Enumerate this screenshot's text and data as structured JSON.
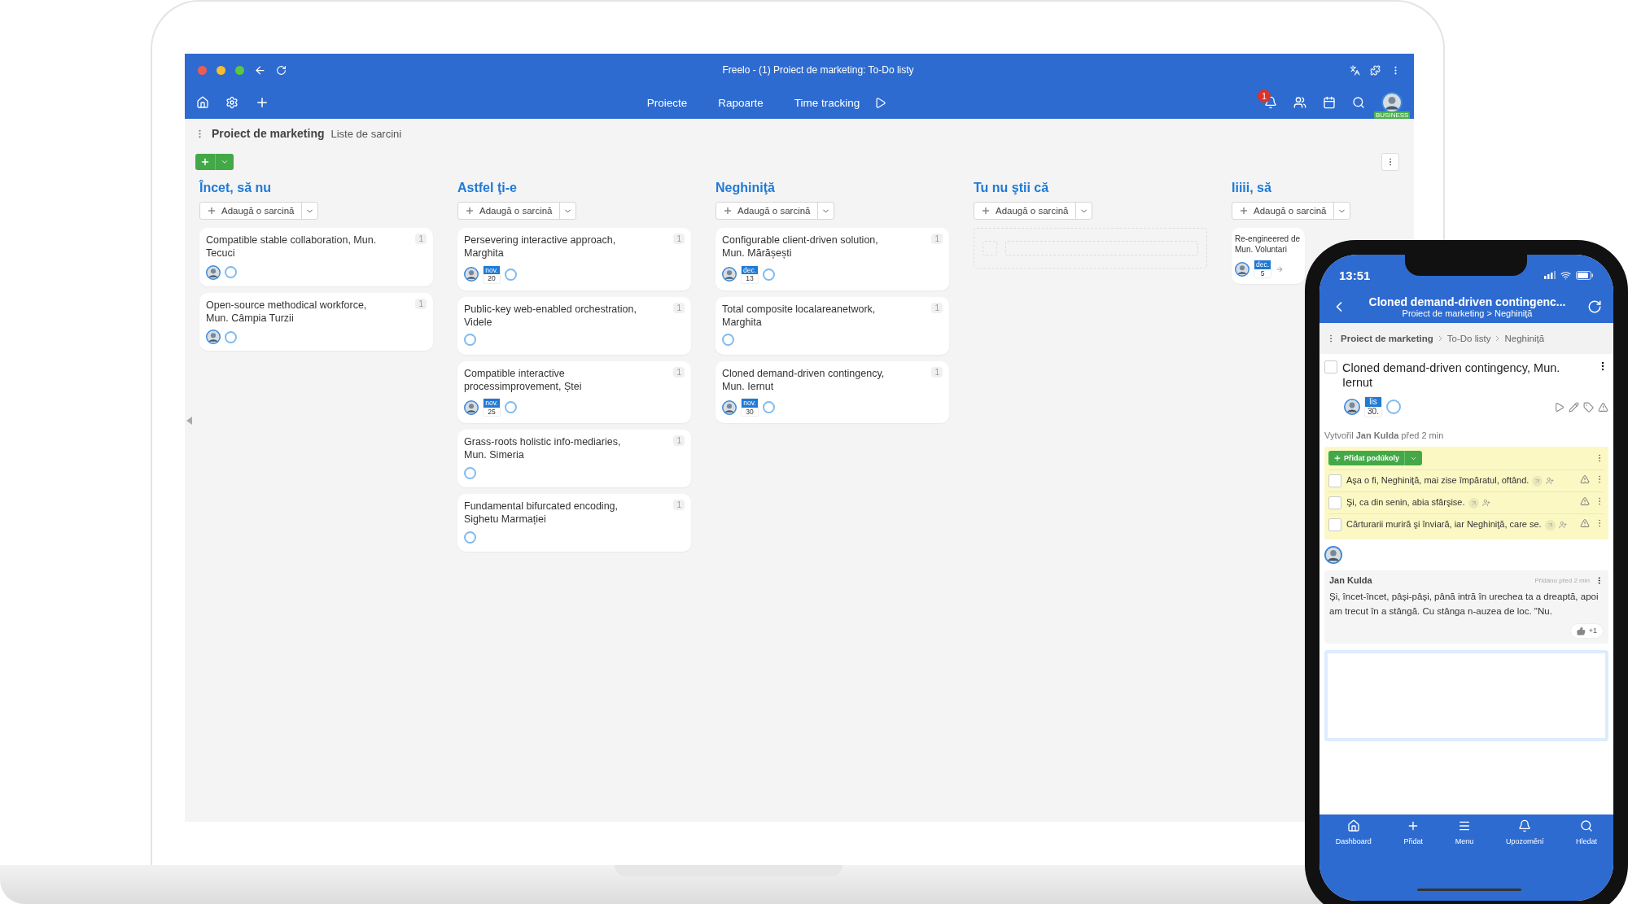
{
  "browser": {
    "title": "Freelo - (1) Proiect de marketing: To-Do listy"
  },
  "nav": {
    "items": [
      "Proiecte",
      "Rapoarte",
      "Time tracking"
    ],
    "notification_count": "1",
    "plan_badge": "BUSINESS"
  },
  "breadcrumb": {
    "project": "Proiect de marketing",
    "page": "Liste de sarcini"
  },
  "columns": [
    {
      "title": "Încet, să nu",
      "add_label": "Adaugă o sarcină",
      "cards": [
        {
          "title": "Compatible stable collaboration, Mun. Tecuci",
          "count": "1",
          "assignee": true
        },
        {
          "title": "Open-source methodical workforce, Mun. Câmpia Turzii",
          "count": "1",
          "assignee": true
        }
      ]
    },
    {
      "title": "Astfel ţi-e",
      "add_label": "Adaugă o sarcină",
      "cards": [
        {
          "title": "Persevering interactive approach, Marghita",
          "count": "1",
          "assignee": true,
          "date": {
            "month": "nov.",
            "day": "20"
          }
        },
        {
          "title": "Public-key web-enabled orchestration, Videle",
          "count": "1",
          "assignee": false
        },
        {
          "title": "Compatible interactive processimprovement, Ștei",
          "count": "1",
          "assignee": true,
          "date": {
            "month": "nov.",
            "day": "25"
          }
        },
        {
          "title": "Grass-roots holistic info-mediaries, Mun. Simeria",
          "count": "1",
          "assignee": false
        },
        {
          "title": "Fundamental bifurcated encoding, Sighetu Marmației",
          "count": "1",
          "assignee": false
        }
      ]
    },
    {
      "title": "Neghiniţă",
      "add_label": "Adaugă o sarcină",
      "cards": [
        {
          "title": "Configurable client-driven solution, Mun. Mărășești",
          "count": "1",
          "assignee": true,
          "date": {
            "month": "dec.",
            "day": "13"
          }
        },
        {
          "title": "Total composite localareanetwork, Marghita",
          "count": "1",
          "assignee": false
        },
        {
          "title": "Cloned demand-driven contingency, Mun. Iernut",
          "count": "1",
          "assignee": true,
          "date": {
            "month": "nov.",
            "day": "30"
          }
        }
      ]
    },
    {
      "title": "Tu nu ştii că",
      "add_label": "Adaugă o sarcină"
    },
    {
      "title": "Iiiii, să",
      "add_label": "Adaugă o sarcină",
      "cards": [
        {
          "title": "Re-engineered de",
          "title_line_2": "Mun. Voluntari",
          "assignee": true,
          "date": {
            "month": "dec.",
            "day": "5"
          },
          "range": true
        }
      ]
    }
  ],
  "phone": {
    "time": "13:51",
    "title": "Cloned demand-driven contingenc...",
    "subtitle": "Proiect de marketing > Neghiniţă",
    "breadcrumb": [
      "Proiect de marketing",
      "To-Do listy",
      "Neghiniţă"
    ],
    "task": {
      "title": "Cloned demand-driven contingency, Mun. Iernut",
      "checked": false,
      "date": {
        "month": "lis",
        "day": "30."
      }
    },
    "created": "Vytvořil **Jan Kulda** před 2 min",
    "add_subtask": "Přidat podúkoly",
    "subtasks": [
      {
        "text": "Aşa o fi, Neghiniţă, mai zise împăratul, oftând.",
        "checked": false
      },
      {
        "text": "Şi, ca din senin, abia sfârşise.",
        "checked": false
      },
      {
        "text": "Cărturarii muriră şi înviară, iar Neghiniţă, care se.",
        "checked": false
      }
    ],
    "comment": {
      "author": "Jan Kulda",
      "time": "Přidáno před 2 min",
      "text": "Şi, încet-încet, pâşi-pâşi, până intră în urechea ta a dreaptă, apoi am trecut în a stângă. Cu stânga n-auzea de loc. \"Nu.",
      "likes": "+1"
    },
    "tabs": [
      {
        "label": "Dashboard",
        "kind": "home"
      },
      {
        "label": "Přidat",
        "kind": "add"
      },
      {
        "label": "Menu",
        "kind": "menu"
      },
      {
        "label": "Upozornění",
        "kind": "bell"
      },
      {
        "label": "Hledat",
        "kind": "search"
      }
    ]
  }
}
